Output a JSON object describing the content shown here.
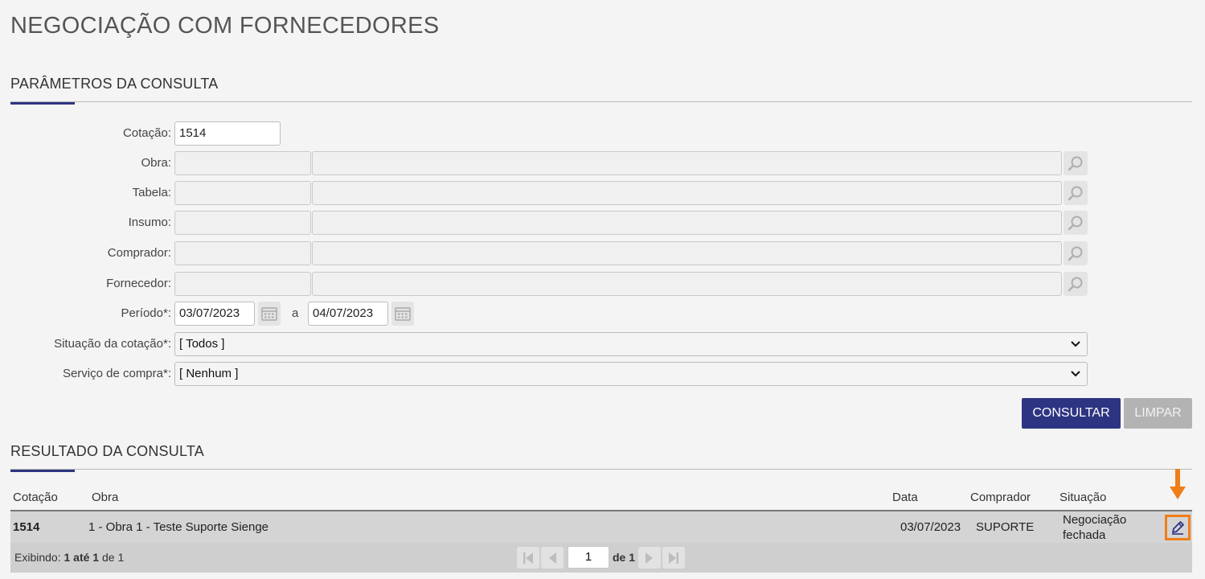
{
  "page": {
    "title": "NEGOCIAÇÃO COM FORNECEDORES"
  },
  "params": {
    "heading": "PARÂMETROS DA CONSULTA",
    "cotacao": {
      "label": "Cotação:",
      "value": "1514"
    },
    "obra": {
      "label": "Obra:"
    },
    "tabela": {
      "label": "Tabela:"
    },
    "insumo": {
      "label": "Insumo:"
    },
    "comprador": {
      "label": "Comprador:"
    },
    "fornecedor": {
      "label": "Fornecedor:"
    },
    "periodo": {
      "label": "Período*:",
      "start": "03/07/2023",
      "separator": "a",
      "end": "04/07/2023"
    },
    "situacao": {
      "label": "Situação da cotação*:",
      "selected": "[ Todos ]"
    },
    "servico": {
      "label": "Serviço de compra*:",
      "selected": "[ Nenhum ]"
    },
    "consultar_label": "CONSULTAR",
    "limpar_label": "LIMPAR"
  },
  "results": {
    "heading": "RESULTADO DA CONSULTA",
    "columns": {
      "cotacao": "Cotação",
      "obra": "Obra",
      "data": "Data",
      "comprador": "Comprador",
      "situacao": "Situação"
    },
    "rows": [
      {
        "cotacao": "1514",
        "obra": "1 - Obra 1 - Teste Suporte Sienge",
        "data": "03/07/2023",
        "comprador": "SUPORTE",
        "situacao_line1": "Negociação",
        "situacao_line2": "fechada",
        "action_icon": "pencil-icon"
      }
    ],
    "footer": {
      "prefix": "Exibindo:",
      "from": "1",
      "ate": "até",
      "to": "1",
      "de": "de",
      "total": "1",
      "page": "1",
      "of_label": "de 1"
    }
  },
  "colors": {
    "accent": "#2d3582",
    "highlight": "#f07d1a"
  }
}
